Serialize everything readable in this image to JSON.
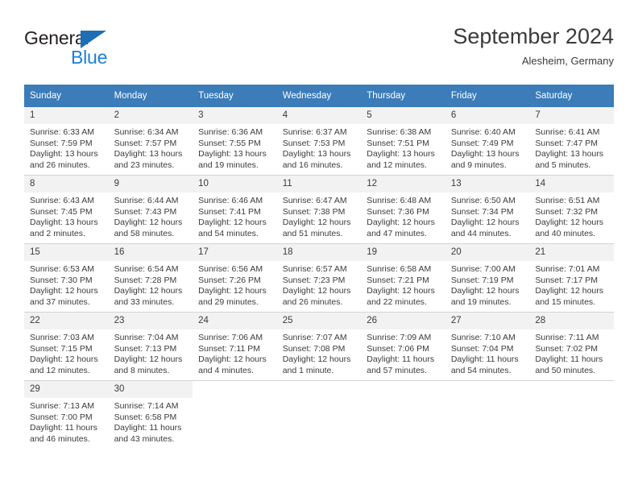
{
  "brand": {
    "name_part1": "General",
    "name_part2": "Blue",
    "triangle_icon": "triangle-icon"
  },
  "header": {
    "title": "September 2024",
    "subtitle": "Alesheim, Germany"
  },
  "colors": {
    "header_blue": "#3b7cb9",
    "brand_blue": "#1c7fd6",
    "daynum_bg": "#f2f2f2",
    "text": "#3b3b3b",
    "row_divider": "#d4d4d4"
  },
  "weekdays": [
    "Sunday",
    "Monday",
    "Tuesday",
    "Wednesday",
    "Thursday",
    "Friday",
    "Saturday"
  ],
  "weeks": [
    [
      {
        "day": "1",
        "sunrise": "Sunrise: 6:33 AM",
        "sunset": "Sunset: 7:59 PM",
        "daylight1": "Daylight: 13 hours",
        "daylight2": "and 26 minutes."
      },
      {
        "day": "2",
        "sunrise": "Sunrise: 6:34 AM",
        "sunset": "Sunset: 7:57 PM",
        "daylight1": "Daylight: 13 hours",
        "daylight2": "and 23 minutes."
      },
      {
        "day": "3",
        "sunrise": "Sunrise: 6:36 AM",
        "sunset": "Sunset: 7:55 PM",
        "daylight1": "Daylight: 13 hours",
        "daylight2": "and 19 minutes."
      },
      {
        "day": "4",
        "sunrise": "Sunrise: 6:37 AM",
        "sunset": "Sunset: 7:53 PM",
        "daylight1": "Daylight: 13 hours",
        "daylight2": "and 16 minutes."
      },
      {
        "day": "5",
        "sunrise": "Sunrise: 6:38 AM",
        "sunset": "Sunset: 7:51 PM",
        "daylight1": "Daylight: 13 hours",
        "daylight2": "and 12 minutes."
      },
      {
        "day": "6",
        "sunrise": "Sunrise: 6:40 AM",
        "sunset": "Sunset: 7:49 PM",
        "daylight1": "Daylight: 13 hours",
        "daylight2": "and 9 minutes."
      },
      {
        "day": "7",
        "sunrise": "Sunrise: 6:41 AM",
        "sunset": "Sunset: 7:47 PM",
        "daylight1": "Daylight: 13 hours",
        "daylight2": "and 5 minutes."
      }
    ],
    [
      {
        "day": "8",
        "sunrise": "Sunrise: 6:43 AM",
        "sunset": "Sunset: 7:45 PM",
        "daylight1": "Daylight: 13 hours",
        "daylight2": "and 2 minutes."
      },
      {
        "day": "9",
        "sunrise": "Sunrise: 6:44 AM",
        "sunset": "Sunset: 7:43 PM",
        "daylight1": "Daylight: 12 hours",
        "daylight2": "and 58 minutes."
      },
      {
        "day": "10",
        "sunrise": "Sunrise: 6:46 AM",
        "sunset": "Sunset: 7:41 PM",
        "daylight1": "Daylight: 12 hours",
        "daylight2": "and 54 minutes."
      },
      {
        "day": "11",
        "sunrise": "Sunrise: 6:47 AM",
        "sunset": "Sunset: 7:38 PM",
        "daylight1": "Daylight: 12 hours",
        "daylight2": "and 51 minutes."
      },
      {
        "day": "12",
        "sunrise": "Sunrise: 6:48 AM",
        "sunset": "Sunset: 7:36 PM",
        "daylight1": "Daylight: 12 hours",
        "daylight2": "and 47 minutes."
      },
      {
        "day": "13",
        "sunrise": "Sunrise: 6:50 AM",
        "sunset": "Sunset: 7:34 PM",
        "daylight1": "Daylight: 12 hours",
        "daylight2": "and 44 minutes."
      },
      {
        "day": "14",
        "sunrise": "Sunrise: 6:51 AM",
        "sunset": "Sunset: 7:32 PM",
        "daylight1": "Daylight: 12 hours",
        "daylight2": "and 40 minutes."
      }
    ],
    [
      {
        "day": "15",
        "sunrise": "Sunrise: 6:53 AM",
        "sunset": "Sunset: 7:30 PM",
        "daylight1": "Daylight: 12 hours",
        "daylight2": "and 37 minutes."
      },
      {
        "day": "16",
        "sunrise": "Sunrise: 6:54 AM",
        "sunset": "Sunset: 7:28 PM",
        "daylight1": "Daylight: 12 hours",
        "daylight2": "and 33 minutes."
      },
      {
        "day": "17",
        "sunrise": "Sunrise: 6:56 AM",
        "sunset": "Sunset: 7:26 PM",
        "daylight1": "Daylight: 12 hours",
        "daylight2": "and 29 minutes."
      },
      {
        "day": "18",
        "sunrise": "Sunrise: 6:57 AM",
        "sunset": "Sunset: 7:23 PM",
        "daylight1": "Daylight: 12 hours",
        "daylight2": "and 26 minutes."
      },
      {
        "day": "19",
        "sunrise": "Sunrise: 6:58 AM",
        "sunset": "Sunset: 7:21 PM",
        "daylight1": "Daylight: 12 hours",
        "daylight2": "and 22 minutes."
      },
      {
        "day": "20",
        "sunrise": "Sunrise: 7:00 AM",
        "sunset": "Sunset: 7:19 PM",
        "daylight1": "Daylight: 12 hours",
        "daylight2": "and 19 minutes."
      },
      {
        "day": "21",
        "sunrise": "Sunrise: 7:01 AM",
        "sunset": "Sunset: 7:17 PM",
        "daylight1": "Daylight: 12 hours",
        "daylight2": "and 15 minutes."
      }
    ],
    [
      {
        "day": "22",
        "sunrise": "Sunrise: 7:03 AM",
        "sunset": "Sunset: 7:15 PM",
        "daylight1": "Daylight: 12 hours",
        "daylight2": "and 12 minutes."
      },
      {
        "day": "23",
        "sunrise": "Sunrise: 7:04 AM",
        "sunset": "Sunset: 7:13 PM",
        "daylight1": "Daylight: 12 hours",
        "daylight2": "and 8 minutes."
      },
      {
        "day": "24",
        "sunrise": "Sunrise: 7:06 AM",
        "sunset": "Sunset: 7:11 PM",
        "daylight1": "Daylight: 12 hours",
        "daylight2": "and 4 minutes."
      },
      {
        "day": "25",
        "sunrise": "Sunrise: 7:07 AM",
        "sunset": "Sunset: 7:08 PM",
        "daylight1": "Daylight: 12 hours",
        "daylight2": "and 1 minute."
      },
      {
        "day": "26",
        "sunrise": "Sunrise: 7:09 AM",
        "sunset": "Sunset: 7:06 PM",
        "daylight1": "Daylight: 11 hours",
        "daylight2": "and 57 minutes."
      },
      {
        "day": "27",
        "sunrise": "Sunrise: 7:10 AM",
        "sunset": "Sunset: 7:04 PM",
        "daylight1": "Daylight: 11 hours",
        "daylight2": "and 54 minutes."
      },
      {
        "day": "28",
        "sunrise": "Sunrise: 7:11 AM",
        "sunset": "Sunset: 7:02 PM",
        "daylight1": "Daylight: 11 hours",
        "daylight2": "and 50 minutes."
      }
    ],
    [
      {
        "day": "29",
        "sunrise": "Sunrise: 7:13 AM",
        "sunset": "Sunset: 7:00 PM",
        "daylight1": "Daylight: 11 hours",
        "daylight2": "and 46 minutes."
      },
      {
        "day": "30",
        "sunrise": "Sunrise: 7:14 AM",
        "sunset": "Sunset: 6:58 PM",
        "daylight1": "Daylight: 11 hours",
        "daylight2": "and 43 minutes."
      },
      null,
      null,
      null,
      null,
      null
    ]
  ]
}
